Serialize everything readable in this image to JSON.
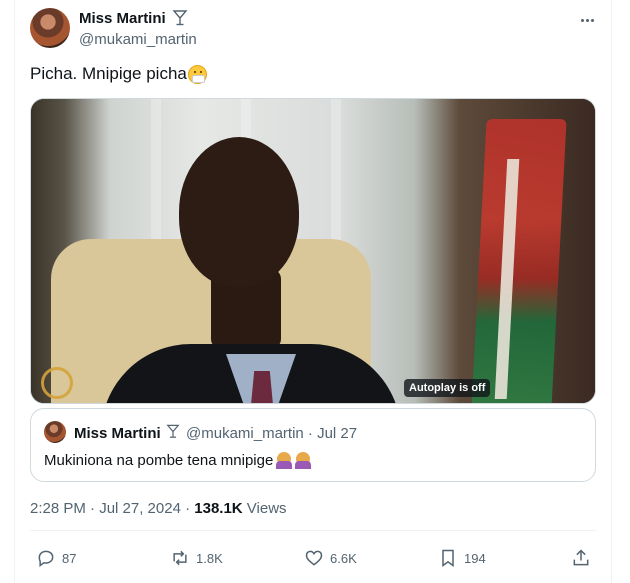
{
  "author": {
    "name": "Miss Martini",
    "handle": "@mukami_martin",
    "avatar_icon": "avatar-icon",
    "badge_icon": "cocktail-glass-icon"
  },
  "tweet": {
    "text": "Picha. Mnipige picha",
    "emoji_icon": "face-with-medical-mask-icon"
  },
  "media": {
    "autoplay_label": "Autoplay is off"
  },
  "quote": {
    "name": "Miss Martini",
    "meta": "@mukami_martin · Jul 27",
    "text": "Mukiniona na pombe tena mnipige",
    "emoji_icons": [
      "woman-facepalming-icon",
      "woman-facepalming-icon"
    ]
  },
  "timestamp": {
    "time": "2:28 PM · Jul 27, 2024 · ",
    "views_count": "138.1K",
    "views_label": " Views"
  },
  "actions": {
    "replies": "87",
    "reposts": "1.8K",
    "likes": "6.6K",
    "bookmarks": "194"
  },
  "colors": {
    "text_primary": "#0f1419",
    "text_secondary": "#536471",
    "border": "#cfd9de"
  }
}
